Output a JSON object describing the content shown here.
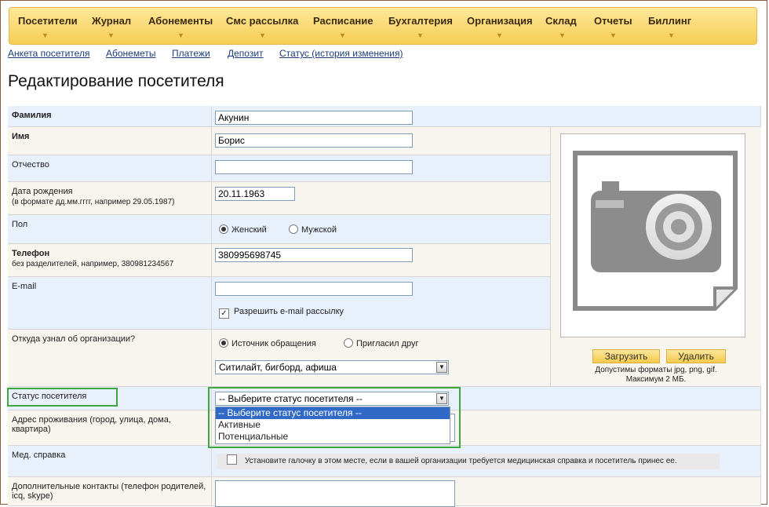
{
  "topnav": {
    "items": [
      "Посетители",
      "Журнал",
      "Абонементы",
      "Смс рассылка",
      "Расписание",
      "Бухгалтерия",
      "Организация",
      "Склад",
      "Отчеты",
      "Биллинг"
    ]
  },
  "subnav": {
    "links": [
      "Анкета посетителя",
      "Абонеметы",
      "Платежи",
      "Депозит",
      "Статус (история изменения)"
    ]
  },
  "page": {
    "title": "Редактирование посетителя"
  },
  "form": {
    "lastname": {
      "label": "Фамилия",
      "value": "Акунин"
    },
    "firstname": {
      "label": "Имя",
      "value": "Борис"
    },
    "patronymic": {
      "label": "Отчество",
      "value": ""
    },
    "birthdate": {
      "label": "Дата рождения",
      "hint": "(в формате дд.мм.гггг, например 29.05.1987)",
      "value": "20.11.1963"
    },
    "gender": {
      "label": "Пол",
      "options": [
        "Женский",
        "Мужской"
      ],
      "selected": "Женский"
    },
    "phone": {
      "label": "Телефон",
      "hint": "без разделителей, например, 380981234567",
      "value": "380995698745"
    },
    "email": {
      "label": "E-mail",
      "value": "",
      "allow_mailing_label": "Разрешить e-mail рассылку",
      "allow_mailing_checked": true
    },
    "source": {
      "label": "Откуда узнал об организации?",
      "options": [
        "Источник обращения",
        "Пригласил друг"
      ],
      "selected": "Источник обращения",
      "select_value": "Ситилайт, бигборд, афиша"
    },
    "status": {
      "label": "Статус посетителя",
      "select_value": "-- Выберите статус посетителя --",
      "options": [
        "-- Выберите статус посетителя --",
        "Активные",
        "Потенциальные"
      ]
    },
    "address": {
      "label": "Адрес проживания (город, улица, дома, квартира)"
    },
    "medical": {
      "label": "Мед. справка",
      "checkbox_text": "Установите галочку в этом месте, если в вашей организации требуется медицинская справка и посетитель принес ее."
    },
    "contacts": {
      "label": "Дополнительные контакты (телефон родителей, icq, skype)"
    }
  },
  "photo": {
    "upload_label": "Загрузить",
    "delete_label": "Удалить",
    "note_line1": "Допустимы форматы jpg, png, gif.",
    "note_line2": "Максимум 2 МБ."
  }
}
